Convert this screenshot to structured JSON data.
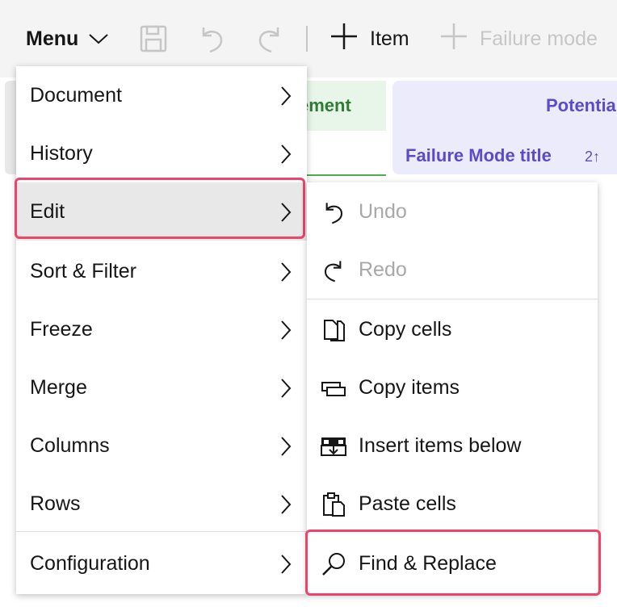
{
  "toolbar": {
    "menu_label": "Menu",
    "add_item_label": "Item",
    "add_failure_mode_label": "Failure mode",
    "icons": {
      "menu_chevron": "chevron-down-icon",
      "save": "save-icon",
      "undo": "undo-icon",
      "redo": "redo-icon",
      "add_item": "plus-icon",
      "add_failure_mode": "plus-icon"
    }
  },
  "table_header": {
    "requirement_partial": "ement",
    "potential_partial": "Potentia",
    "failure_mode_title": "Failure Mode title",
    "sort_indicator": "2↑"
  },
  "menu": {
    "items": [
      {
        "label": "Document"
      },
      {
        "label": "History"
      },
      {
        "label": "Edit"
      },
      {
        "label": "Sort & Filter"
      },
      {
        "label": "Freeze"
      },
      {
        "label": "Merge"
      },
      {
        "label": "Columns"
      },
      {
        "label": "Rows"
      },
      {
        "label": "Configuration"
      }
    ]
  },
  "edit_submenu": {
    "items": [
      {
        "label": "Undo",
        "icon": "undo-icon",
        "enabled": false
      },
      {
        "label": "Redo",
        "icon": "redo-icon",
        "enabled": false
      },
      {
        "label": "Copy cells",
        "icon": "copy-icon",
        "enabled": true
      },
      {
        "label": "Copy items",
        "icon": "copy-items-icon",
        "enabled": true
      },
      {
        "label": "Insert items below",
        "icon": "insert-below-icon",
        "enabled": true
      },
      {
        "label": "Paste cells",
        "icon": "paste-icon",
        "enabled": true
      },
      {
        "label": "Find & Replace",
        "icon": "search-icon",
        "enabled": true
      }
    ]
  },
  "colors": {
    "highlight": "#f0436b",
    "requirement_green": "#2e7d32",
    "potential_purple": "#5b4bc8",
    "disabled_text": "#a8a8a8"
  }
}
